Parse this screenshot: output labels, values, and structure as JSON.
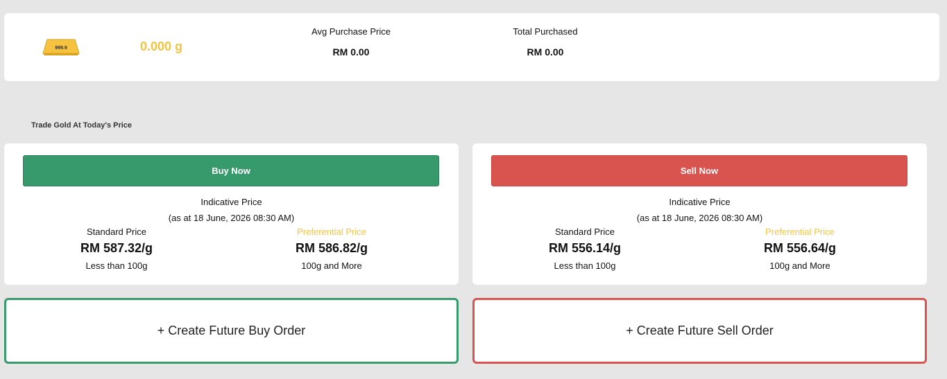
{
  "summary": {
    "bar_label": "999.9",
    "weight": "0.000 g",
    "avg_purchase_label": "Avg Purchase Price",
    "avg_purchase_value": "RM 0.00",
    "total_purchased_label": "Total Purchased",
    "total_purchased_value": "RM 0.00"
  },
  "section_title": "Trade Gold At Today's Price",
  "buy": {
    "button_label": "Buy Now",
    "indicative_label": "Indicative Price",
    "as_at": "(as at 18 June, 2026 08:30 AM)",
    "standard_label": "Standard Price",
    "standard_value": "RM 587.32/g",
    "standard_note": "Less than 100g",
    "preferential_label": "Preferential Price",
    "preferential_value": "RM 586.82/g",
    "preferential_note": "100g and More",
    "future_label": "+ Create Future Buy Order"
  },
  "sell": {
    "button_label": "Sell Now",
    "indicative_label": "Indicative Price",
    "as_at": "(as at 18 June, 2026 08:30 AM)",
    "standard_label": "Standard Price",
    "standard_value": "RM 556.14/g",
    "standard_note": "Less than 100g",
    "preferential_label": "Preferential Price",
    "preferential_value": "RM 556.64/g",
    "preferential_note": "100g and More",
    "future_label": "+ Create Future Sell Order"
  },
  "colors": {
    "gold": "#f5c340",
    "buy_green": "#379a6d",
    "sell_red": "#d9534f",
    "background": "#e6e6e6"
  },
  "icons": {
    "gold_bar": "gold-bar-icon"
  }
}
